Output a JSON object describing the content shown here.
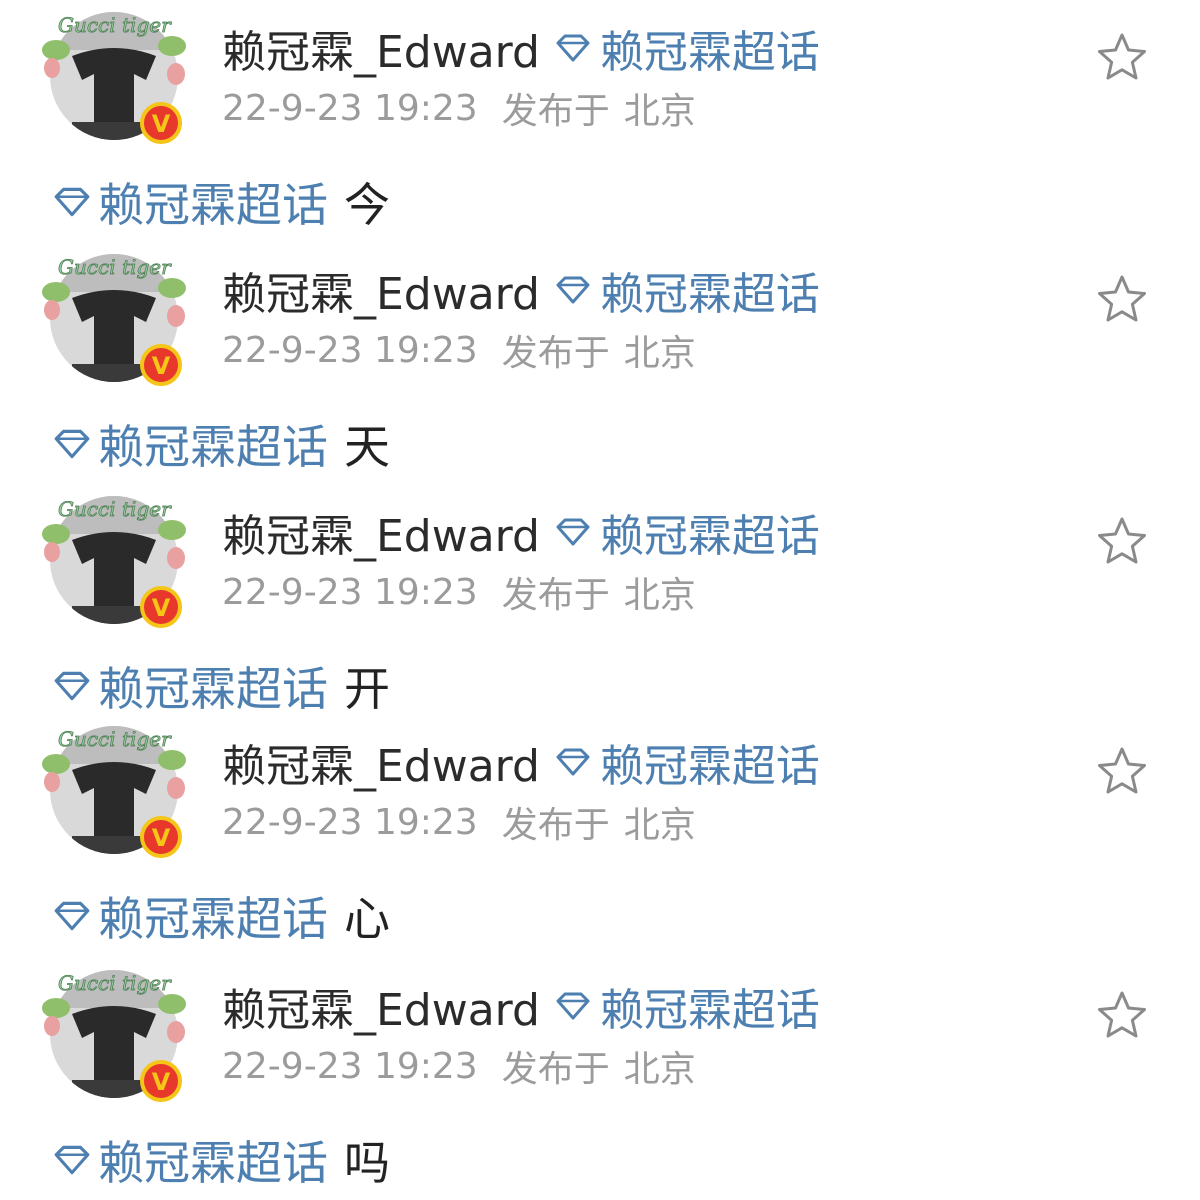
{
  "colors": {
    "topic_link": "#4d7fb0",
    "username": "#2b2b2b",
    "meta": "#9b9b9b",
    "verified_badge": "#e8382c",
    "verified_badge_ring": "#f5c518",
    "star_outline": "#8a8a8a"
  },
  "icons": {
    "topic": "diamond-icon",
    "favorite": "star-outline-icon",
    "verified": "verified-v-badge-icon"
  },
  "posts": [
    {
      "username": "赖冠霖_Edward",
      "header_topic": "赖冠霖超话",
      "timestamp": "22-9-23 19:23",
      "published_label": "发布于",
      "location": "北京",
      "body_topic": "赖冠霖超话",
      "body_text": "今",
      "verified_badge_text": "V",
      "avatar_overlay_text": "Gucci tiger"
    },
    {
      "username": "赖冠霖_Edward",
      "header_topic": "赖冠霖超话",
      "timestamp": "22-9-23 19:23",
      "published_label": "发布于",
      "location": "北京",
      "body_topic": "赖冠霖超话",
      "body_text": "天",
      "verified_badge_text": "V",
      "avatar_overlay_text": "Gucci tiger"
    },
    {
      "username": "赖冠霖_Edward",
      "header_topic": "赖冠霖超话",
      "timestamp": "22-9-23 19:23",
      "published_label": "发布于",
      "location": "北京",
      "body_topic": "赖冠霖超话",
      "body_text": "开",
      "verified_badge_text": "V",
      "avatar_overlay_text": "Gucci tiger"
    },
    {
      "username": "赖冠霖_Edward",
      "header_topic": "赖冠霖超话",
      "timestamp": "22-9-23 19:23",
      "published_label": "发布于",
      "location": "北京",
      "body_topic": "赖冠霖超话",
      "body_text": "心",
      "verified_badge_text": "V",
      "avatar_overlay_text": "Gucci tiger"
    },
    {
      "username": "赖冠霖_Edward",
      "header_topic": "赖冠霖超话",
      "timestamp": "22-9-23 19:23",
      "published_label": "发布于",
      "location": "北京",
      "body_topic": "赖冠霖超话",
      "body_text": "吗",
      "verified_badge_text": "V",
      "avatar_overlay_text": "Gucci tiger"
    }
  ]
}
